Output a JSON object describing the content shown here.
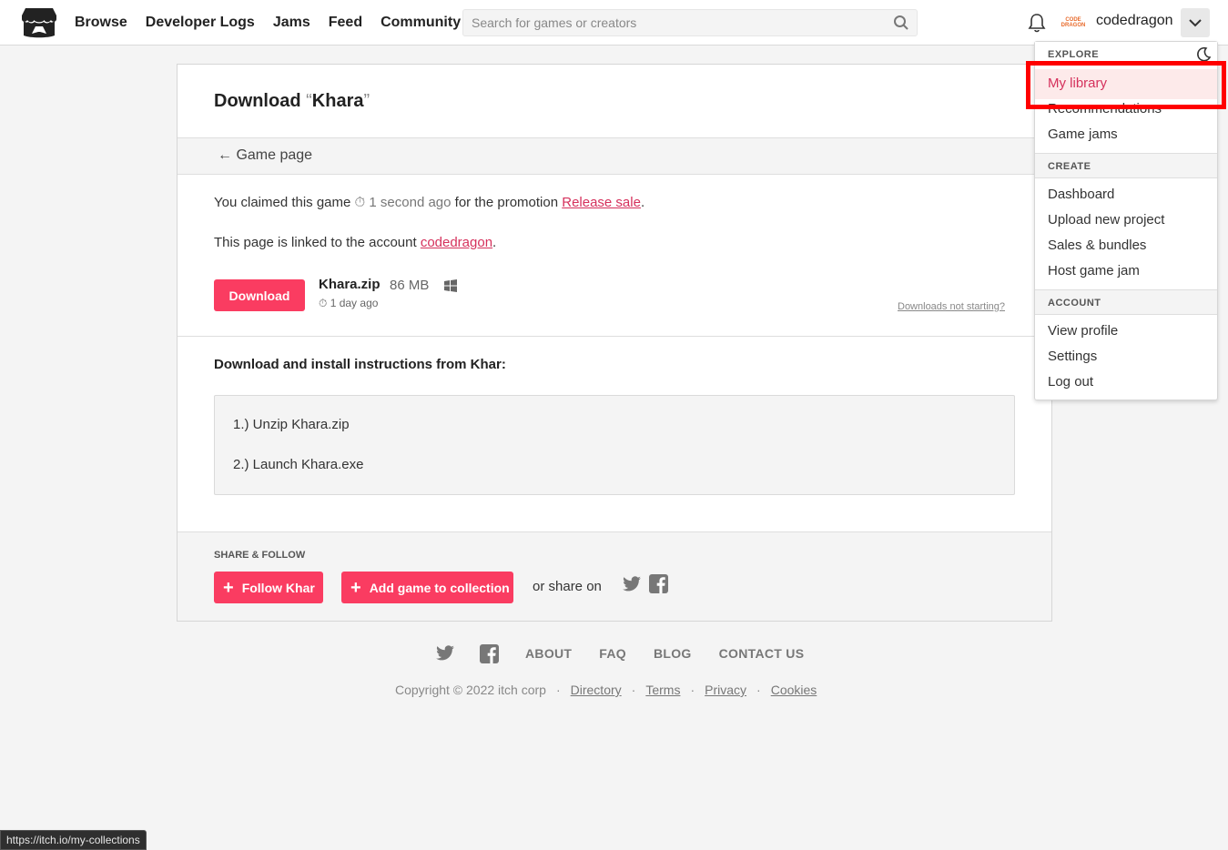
{
  "header": {
    "nav": [
      "Browse",
      "Developer Logs",
      "Jams",
      "Feed",
      "Community"
    ],
    "search_placeholder": "Search for games or creators",
    "username": "codedragon",
    "avatar_text": "CODE DRAGON"
  },
  "page": {
    "title_prefix": "Download ",
    "open_quote": "“",
    "game_name": "Khara",
    "close_quote": "”",
    "game_page_link": "Game page",
    "claimed_text": "You claimed this game ",
    "claimed_time": "1 second ago",
    "promo_text": " for the promotion ",
    "promo_link": "Release sale",
    "period": ".",
    "linked_text": "This page is linked to the account ",
    "linked_account": "codedragon",
    "download_button": "Download",
    "file_name": "Khara.zip",
    "file_size": "86 MB",
    "file_date": "1 day ago",
    "downloads_not_starting": "Downloads not starting?",
    "instructions_heading": "Download and install instructions from Khar:",
    "instructions": [
      "1.) Unzip Khara.zip",
      "2.) Launch Khara.exe"
    ],
    "share_label": "SHARE & FOLLOW",
    "follow_button": "Follow Khar",
    "collection_button": "Add game to collection",
    "or_share": "or share on"
  },
  "footer": {
    "links": [
      "ABOUT",
      "FAQ",
      "BLOG",
      "CONTACT US"
    ],
    "copyright": "Copyright © 2022 itch corp",
    "legal_links": [
      "Directory",
      "Terms",
      "Privacy",
      "Cookies"
    ]
  },
  "dropdown": {
    "explore_label": "EXPLORE",
    "explore_items": [
      "My library",
      "Recommendations",
      "Game jams"
    ],
    "create_label": "CREATE",
    "create_items": [
      "Dashboard",
      "Upload new project",
      "Sales & bundles",
      "Host game jam"
    ],
    "account_label": "ACCOUNT",
    "account_items": [
      "View profile",
      "Settings",
      "Log out"
    ]
  },
  "statusbar": "https://itch.io/my-collections",
  "colors": {
    "accent": "#fa3c61",
    "link": "#d5315c",
    "highlight": "#ff0000"
  }
}
